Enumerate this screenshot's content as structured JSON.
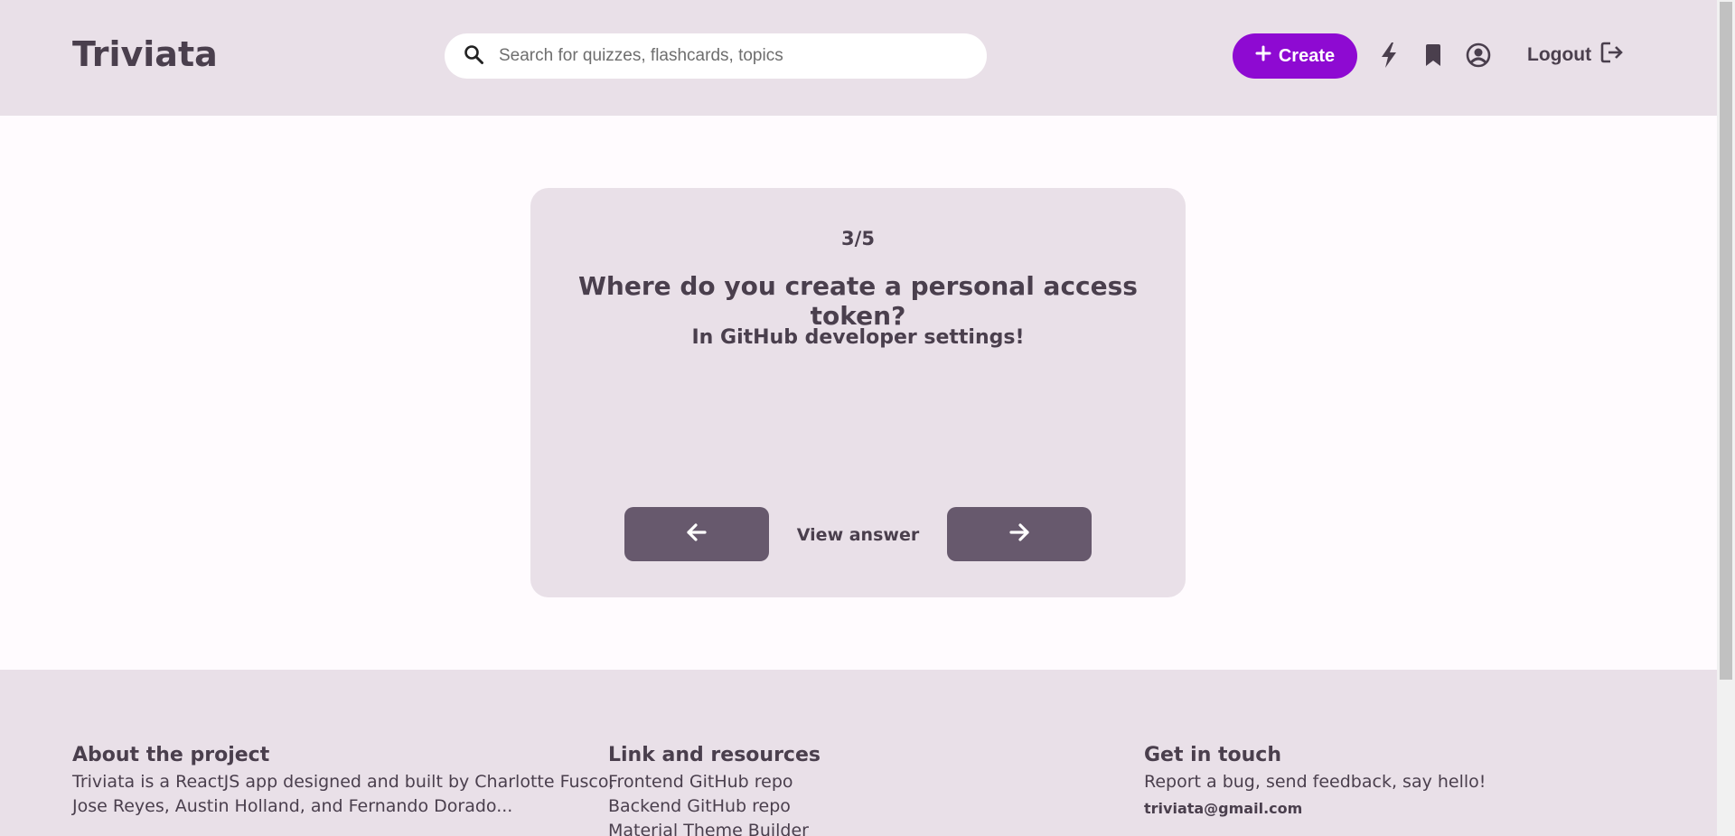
{
  "header": {
    "logo": "Triviata",
    "search_placeholder": "Search for quizzes, flashcards, topics",
    "search_icon": "search-icon",
    "create_label": "Create",
    "icons": [
      "lightning-icon",
      "bookmark-icon",
      "account-circle-icon"
    ],
    "logout_label": "Logout"
  },
  "flashcard": {
    "counter": "3/5",
    "question": "Where do you create a personal access token?",
    "answer": "In GitHub developer settings!",
    "view_answer_label": "View answer",
    "prev_icon": "arrow-left-icon",
    "next_icon": "arrow-right-icon"
  },
  "footer": {
    "about": {
      "title": "About the project",
      "text_line1": "Triviata is a ReactJS app designed and built by Charlotte Fusco,",
      "text_line2": "Jose Reyes, Austin Holland, and Fernando Dorado..."
    },
    "links": {
      "title": "Link and resources",
      "items": [
        "Frontend GitHub repo",
        "Backend GitHub repo",
        "Material Theme Builder"
      ]
    },
    "contact": {
      "title": "Get in touch",
      "text": "Report a bug, send feedback, say hello!",
      "email": "triviata@gmail.com"
    }
  },
  "colors": {
    "surface": "#e9e0e8",
    "background": "#fffbfe",
    "primary": "#8e0ad2",
    "button": "#67596d",
    "text": "#4a3f4d"
  }
}
